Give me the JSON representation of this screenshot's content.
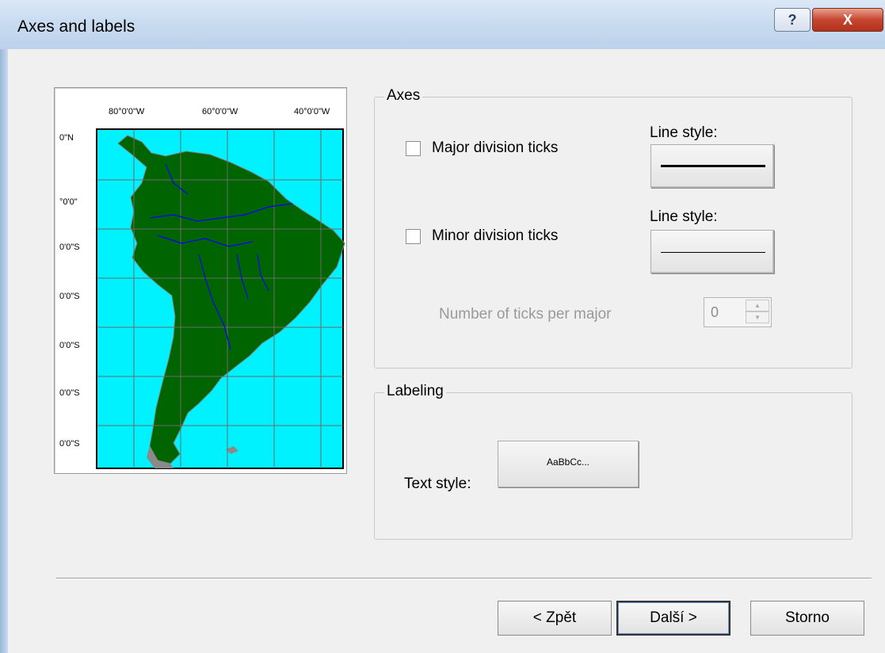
{
  "window": {
    "title": "Axes and labels",
    "help_glyph": "?",
    "close_glyph": "X"
  },
  "preview": {
    "lon_labels": [
      "80°0'0\"W",
      "60°0'0\"W",
      "40°0'0\"W"
    ],
    "lat_labels": [
      "0\"N",
      "°0'0\"",
      "0'0\"S",
      "0'0\"S",
      "0'0\"S",
      "0'0\"S",
      "0'0\"S"
    ],
    "colors": {
      "ocean": "#00f2ff",
      "land": "#006400",
      "rivers": "#0000ff",
      "borders": "#8c8c8c"
    }
  },
  "axes": {
    "legend": "Axes",
    "major_label": "Major division ticks",
    "minor_label": "Minor division ticks",
    "line_style_label_major": "Line style:",
    "line_style_label_minor": "Line style:",
    "ticks_per_major_label": "Number of ticks per major",
    "ticks_per_major_value": "0",
    "major_checked": false,
    "minor_checked": false
  },
  "labeling": {
    "legend": "Labeling",
    "text_style_label": "Text style:",
    "text_style_sample": "AaBbCc..."
  },
  "buttons": {
    "back": "< Zpět",
    "next": "Další >",
    "cancel": "Storno"
  }
}
